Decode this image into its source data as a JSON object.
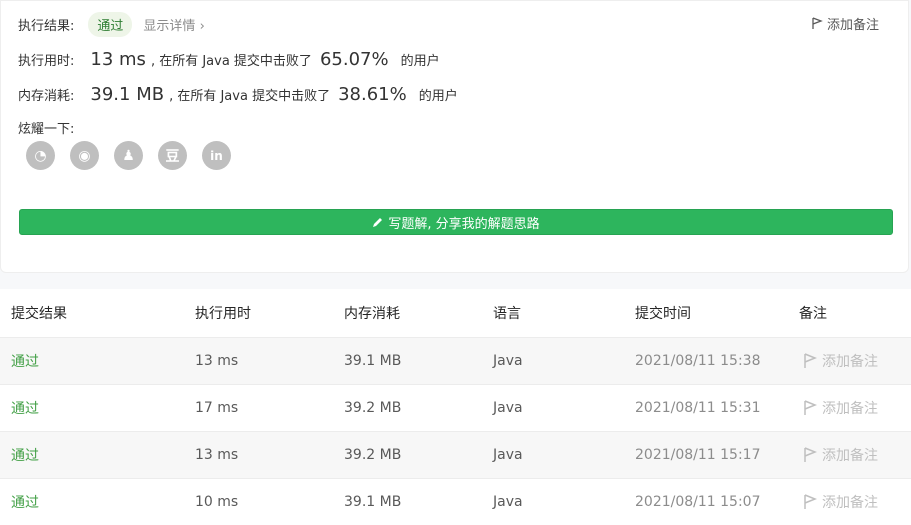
{
  "summary": {
    "result_label": "执行结果:",
    "result_badge": "通过",
    "detail_link": "显示详情",
    "add_note": "添加备注",
    "time_label": "执行用时:",
    "time_value": "13 ms",
    "time_text": ", 在所有 Java 提交中击败了",
    "time_pct": "65.07%",
    "time_suffix": "的用户",
    "mem_label": "内存消耗:",
    "mem_value": "39.1 MB",
    "mem_text": ", 在所有 Java 提交中击败了",
    "mem_pct": "38.61%",
    "mem_suffix": "的用户",
    "share_label": "炫耀一下:",
    "share_icons": [
      "wechat-icon",
      "weibo-icon",
      "qq-icon",
      "douban-icon",
      "linkedin-icon"
    ],
    "share_glyphs": [
      "◔",
      "◉",
      "♟",
      "豆",
      "in"
    ],
    "write_button": "写题解, 分享我的解题思路"
  },
  "table": {
    "headers": [
      "提交结果",
      "执行用时",
      "内存消耗",
      "语言",
      "提交时间",
      "备注"
    ],
    "rows": [
      {
        "status": "通过",
        "time": "13 ms",
        "memory": "39.1 MB",
        "language": "Java",
        "submitted": "2021/08/11 15:38",
        "note": "添加备注"
      },
      {
        "status": "通过",
        "time": "17 ms",
        "memory": "39.2 MB",
        "language": "Java",
        "submitted": "2021/08/11 15:31",
        "note": "添加备注"
      },
      {
        "status": "通过",
        "time": "13 ms",
        "memory": "39.2 MB",
        "language": "Java",
        "submitted": "2021/08/11 15:17",
        "note": "添加备注"
      },
      {
        "status": "通过",
        "time": "10 ms",
        "memory": "39.1 MB",
        "language": "Java",
        "submitted": "2021/08/11 15:07",
        "note": "添加备注"
      }
    ]
  },
  "colors": {
    "accent_green": "#2db55d",
    "status_green": "#43a047",
    "icon_gray": "#bfbfbf"
  }
}
